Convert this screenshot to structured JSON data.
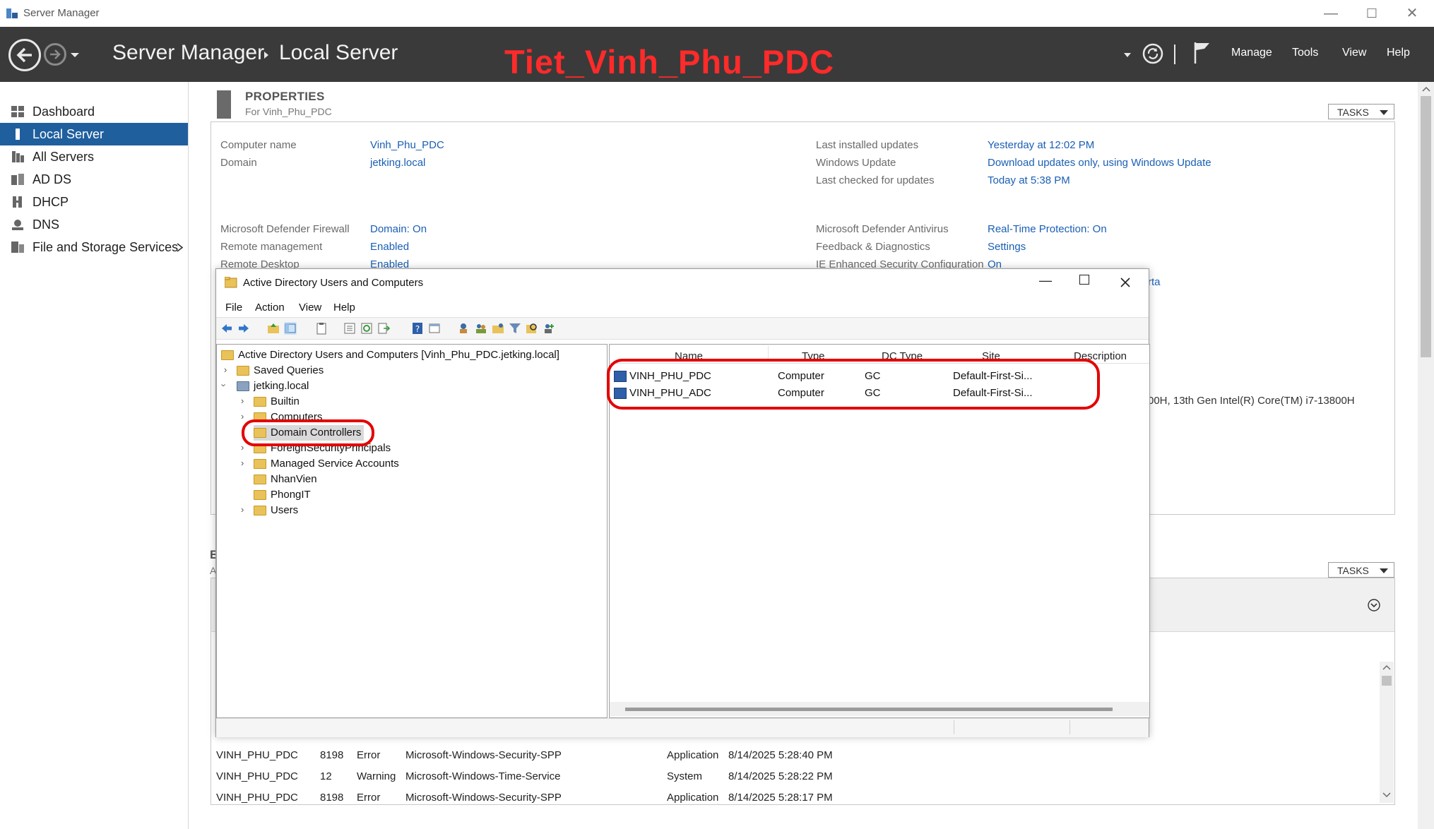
{
  "window": {
    "title": "Server Manager",
    "controls": [
      "—",
      "☐",
      "✕"
    ]
  },
  "header": {
    "app": "Server Manager",
    "page": "Local Server",
    "banner": "Tiet_Vinh_Phu_PDC",
    "menu": [
      "Manage",
      "Tools",
      "View",
      "Help"
    ]
  },
  "sidebar": {
    "items": [
      {
        "label": "Dashboard",
        "icon": "dashboard-icon"
      },
      {
        "label": "Local Server",
        "icon": "server-icon",
        "active": true
      },
      {
        "label": "All Servers",
        "icon": "servers-icon"
      },
      {
        "label": "AD DS",
        "icon": "adds-icon"
      },
      {
        "label": "DHCP",
        "icon": "dhcp-icon"
      },
      {
        "label": "DNS",
        "icon": "dns-icon"
      },
      {
        "label": "File and Storage Services",
        "icon": "storage-icon"
      }
    ]
  },
  "properties": {
    "title": "PROPERTIES",
    "subtitle": "For Vinh_Phu_PDC",
    "tasks": "TASKS",
    "left": [
      {
        "label": "Computer name",
        "value": "Vinh_Phu_PDC"
      },
      {
        "label": "Domain",
        "value": "jetking.local"
      },
      {
        "label": "Microsoft Defender Firewall",
        "value": "Domain: On"
      },
      {
        "label": "Remote management",
        "value": "Enabled"
      },
      {
        "label": "Remote Desktop",
        "value": "Enabled"
      }
    ],
    "right": [
      {
        "label": "Last installed updates",
        "value": "Yesterday at 12:02 PM"
      },
      {
        "label": "Windows Update",
        "value": "Download updates only, using Windows Update"
      },
      {
        "label": "Last checked for updates",
        "value": "Today at 5:38 PM"
      },
      {
        "label": "Microsoft Defender Antivirus",
        "value": "Real-Time Protection: On"
      },
      {
        "label": "Feedback & Diagnostics",
        "value": "Settings"
      },
      {
        "label": "IE Enhanced Security Configuration",
        "value": "On"
      }
    ],
    "partial_tz": "rta",
    "partial_cpu": "00H, 13th Gen Intel(R) Core(TM) i7-13800H"
  },
  "events": {
    "tasks": "TASKS",
    "partial_letters": [
      "E",
      "A"
    ],
    "rows": [
      {
        "server": "VINH_PHU_PDC",
        "id": "8198",
        "severity": "Error",
        "source": "Microsoft-Windows-Security-SPP",
        "log": "Application",
        "date": "8/14/2025 5:28:40 PM"
      },
      {
        "server": "VINH_PHU_PDC",
        "id": "12",
        "severity": "Warning",
        "source": "Microsoft-Windows-Time-Service",
        "log": "System",
        "date": "8/14/2025 5:28:22 PM"
      },
      {
        "server": "VINH_PHU_PDC",
        "id": "8198",
        "severity": "Error",
        "source": "Microsoft-Windows-Security-SPP",
        "log": "Application",
        "date": "8/14/2025 5:28:17 PM"
      }
    ]
  },
  "aduc": {
    "title": "Active Directory Users and Computers",
    "menu": [
      "File",
      "Action",
      "View",
      "Help"
    ],
    "tree": {
      "root": "Active Directory Users and Computers [Vinh_Phu_PDC.jetking.local]",
      "saved": "Saved Queries",
      "domain": "jetking.local",
      "children": [
        "Builtin",
        "Computers",
        "Domain Controllers",
        "ForeignSecurityPrincipals",
        "Managed Service Accounts",
        "NhanVien",
        "PhongIT",
        "Users"
      ]
    },
    "columns": [
      "Name",
      "Type",
      "DC Type",
      "Site",
      "Description"
    ],
    "rows": [
      {
        "name": "VINH_PHU_PDC",
        "type": "Computer",
        "dctype": "GC",
        "site": "Default-First-Si..."
      },
      {
        "name": "VINH_PHU_ADC",
        "type": "Computer",
        "dctype": "GC",
        "site": "Default-First-Si..."
      }
    ]
  },
  "colors": {
    "accent": "#1f5f9e",
    "header_bg": "#3a3a3a",
    "link": "#1a5fb4",
    "highlight_ring": "#e30000",
    "banner": "#ff2a2a"
  }
}
